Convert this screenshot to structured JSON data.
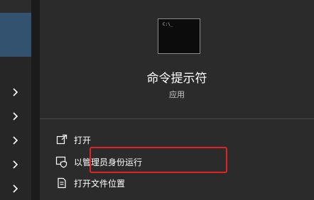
{
  "app": {
    "name": "命令提示符",
    "type": "应用",
    "icon": "command-prompt-icon",
    "icon_prompt_text": "C:\\_"
  },
  "actions": [
    {
      "label": "打开",
      "icon": "open-icon"
    },
    {
      "label": "以管理员身份运行",
      "icon": "shield-icon"
    },
    {
      "label": "打开文件位置",
      "icon": "file-location-icon"
    }
  ],
  "highlight": {
    "target": "以管理员身份运行",
    "color": "#e02424"
  },
  "colors": {
    "panel_bg": "#2b2b2b",
    "selected_result": "#33526f",
    "text": "#ffffff"
  }
}
